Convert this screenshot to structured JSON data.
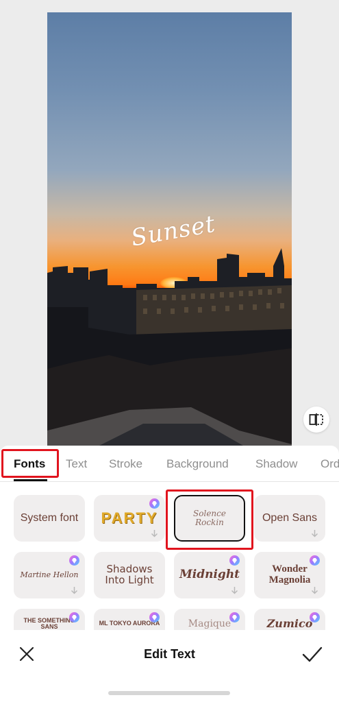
{
  "preview": {
    "overlay_text": "Sunset",
    "compare_icon": "compare-icon"
  },
  "tabs": [
    {
      "label": "Fonts",
      "active": true
    },
    {
      "label": "Text"
    },
    {
      "label": "Stroke"
    },
    {
      "label": "Background"
    },
    {
      "label": "Shadow"
    },
    {
      "label": "Ord"
    }
  ],
  "fonts": [
    {
      "label": "System font",
      "premium": false,
      "download": false
    },
    {
      "label": "PARTY",
      "premium": true,
      "download": true
    },
    {
      "label": "Solence Rockin",
      "premium": false,
      "download": false,
      "selected": true
    },
    {
      "label": "Open Sans",
      "premium": false,
      "download": true
    },
    {
      "label": "Martine Hellon",
      "premium": true,
      "download": true
    },
    {
      "label": "Shadows Into Light",
      "premium": false,
      "download": false
    },
    {
      "label": "Midnight",
      "premium": true,
      "download": true
    },
    {
      "label": "Wonder Magnolia",
      "premium": true,
      "download": true
    },
    {
      "label": "THE SOMETHING SANS",
      "premium": true,
      "download": false
    },
    {
      "label": "ML TOKYO AURORA",
      "premium": true,
      "download": false
    },
    {
      "label": "Magique",
      "premium": true,
      "download": false
    },
    {
      "label": "Zumico",
      "premium": true,
      "download": false
    }
  ],
  "footer": {
    "title": "Edit Text",
    "close_icon": "close-icon",
    "confirm_icon": "check-icon"
  },
  "colors": {
    "highlight": "#e1141e",
    "card_bg": "#f0eeee",
    "font_text": "#6a3f35",
    "party_gold": "#e0a92a"
  }
}
